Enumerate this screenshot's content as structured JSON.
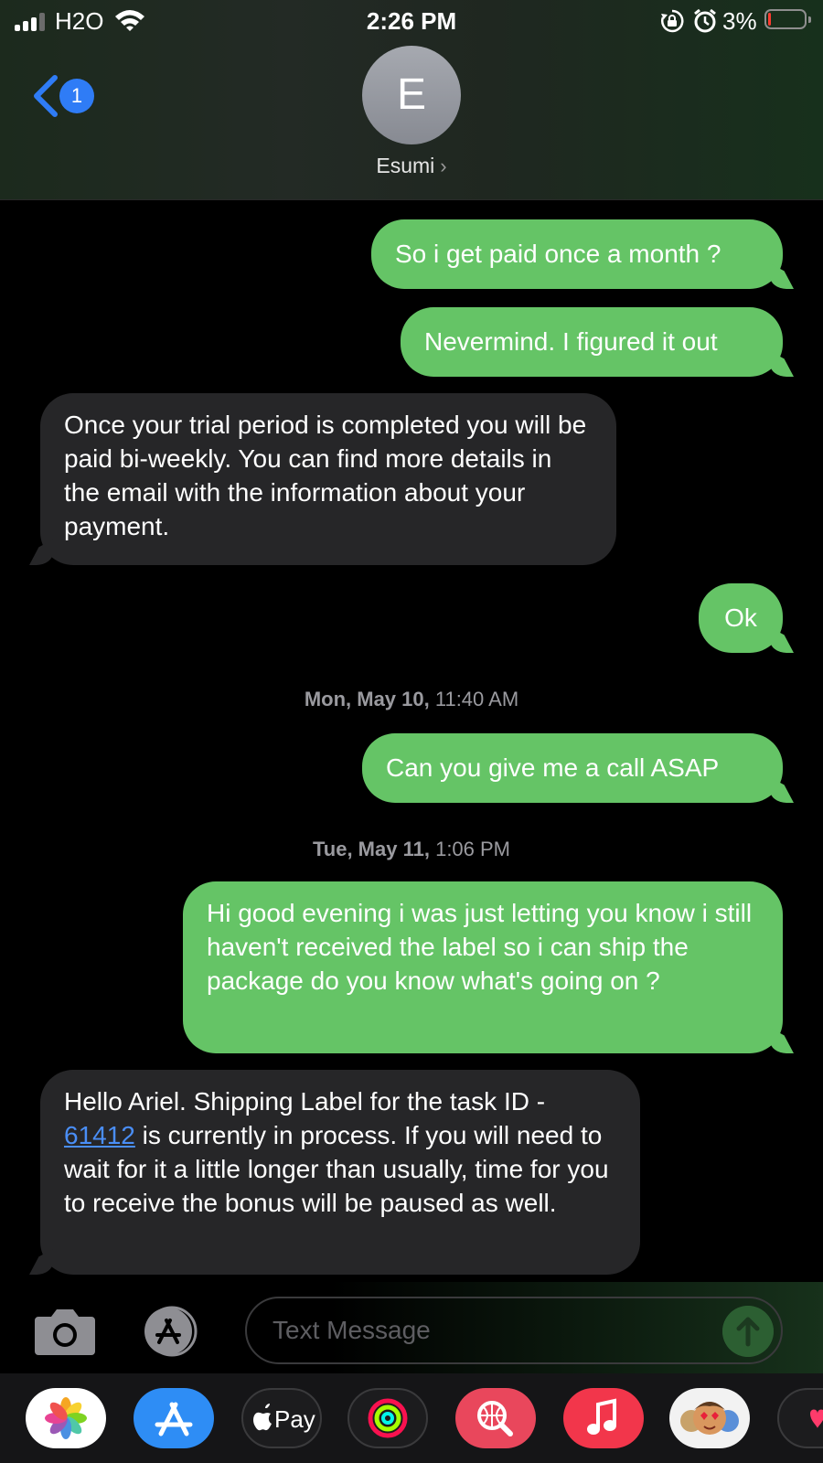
{
  "status_bar": {
    "carrier": "H2O",
    "time": "2:26 PM",
    "battery_percent": "3%",
    "battery_level": 0.03,
    "icons": [
      "signal-icon",
      "wifi-icon",
      "rotation-lock-icon",
      "alarm-icon",
      "battery-icon"
    ]
  },
  "header": {
    "back_badge": "1",
    "avatar_initial": "E",
    "contact_name": "Esumi",
    "contact_chevron": "›"
  },
  "messages": [
    {
      "direction": "outgoing",
      "text": "So i get paid once a month ?"
    },
    {
      "direction": "outgoing",
      "text": "Nevermind. I figured it out"
    },
    {
      "direction": "incoming",
      "text": "Once your trial period is completed you will be paid bi-weekly. You can find more details in the email with the information about your payment."
    },
    {
      "direction": "outgoing",
      "text": "Ok"
    },
    {
      "direction": "timestamp",
      "day": "Mon, May 10,",
      "time": "11:40 AM"
    },
    {
      "direction": "outgoing",
      "text": "Can you give me a call ASAP"
    },
    {
      "direction": "timestamp",
      "day": "Tue, May 11,",
      "time": "1:06 PM"
    },
    {
      "direction": "outgoing",
      "text": "Hi good evening i was just letting you know i still haven't received the label so i can ship the package do you know what's going on ?"
    },
    {
      "direction": "incoming",
      "text_before": "Hello Ariel. Shipping Label for the task ID - ",
      "link": "61412",
      "text_after": " is currently in process. If you will need to wait for it a little longer than usually, time for you to receive the bonus will be paused as well."
    }
  ],
  "compose": {
    "placeholder": "Text Message"
  },
  "app_drawer": {
    "pay_label": "Pay",
    "apps": [
      "photos-app-icon",
      "app-store-app-icon",
      "apple-pay-app-icon",
      "activity-app-icon",
      "web-search-app-icon",
      "music-app-icon",
      "memoji-app-icon",
      "digital-touch-app-icon"
    ]
  },
  "colors": {
    "outgoing_bubble": "#65c466",
    "incoming_bubble": "#262628",
    "link": "#4a8ef6",
    "back_badge": "#2f7cf6"
  }
}
